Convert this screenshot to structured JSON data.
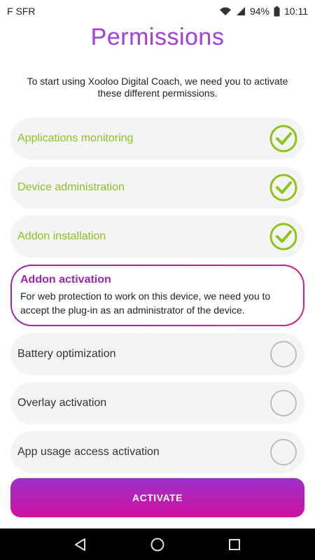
{
  "status_bar": {
    "carrier": "F SFR",
    "battery": "94%",
    "time": "10:11"
  },
  "title": "Permissions",
  "intro": "To start using Xooloo Digital Coach, we need you to activate these different permissions.",
  "permissions": [
    {
      "label": "Applications monitoring",
      "state": "done"
    },
    {
      "label": "Device administration",
      "state": "done"
    },
    {
      "label": "Addon installation",
      "state": "done"
    },
    {
      "label": "Addon activation",
      "state": "active",
      "description": "For web protection to work on this device, we need you to accept the plug-in as an administrator of the device."
    },
    {
      "label": "Battery optimization",
      "state": "pending"
    },
    {
      "label": "Overlay activation",
      "state": "pending"
    },
    {
      "label": "App usage access activation",
      "state": "pending"
    }
  ],
  "activate_button": "ACTIVATE",
  "colors": {
    "accent_purple": "#9c27b0",
    "accent_pink": "#d81b8a",
    "done_green": "#8dc21f",
    "pending_gray": "#bdbdbd"
  },
  "icons": {
    "done": "check-circle-icon",
    "pending": "empty-circle-icon",
    "nav_back": "back-triangle-icon",
    "nav_home": "home-circle-icon",
    "nav_recent": "recent-square-icon"
  }
}
